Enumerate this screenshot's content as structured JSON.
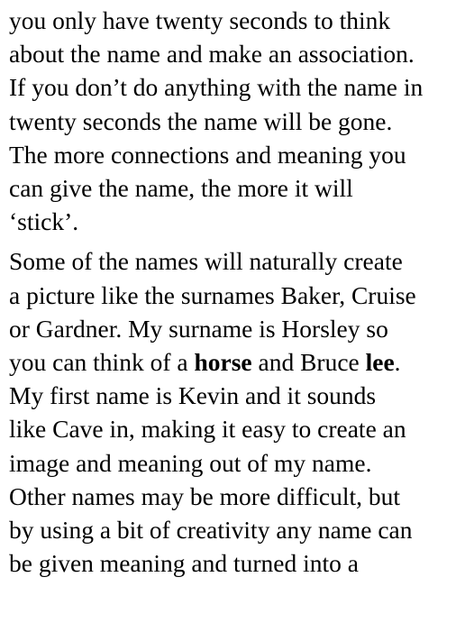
{
  "paragraph_1": {
    "lines": [
      "you only have twenty seconds to think",
      "about the name and make an association.",
      "If you don’t do anything with the name in",
      "twenty seconds the name will be gone.",
      "The more connections and meaning you",
      "can give the name, the more it will",
      "‘stick’."
    ]
  },
  "paragraph_2": {
    "line_1": "Some of the names will naturally create",
    "line_2": "a picture like the surnames Baker, Cruise",
    "line_3": "or Gardner. My surname is Horsley so",
    "line_4_part_1": "you can think of a ",
    "line_4_bold_1": "horse",
    "line_4_part_2": " and Bruce ",
    "line_4_bold_2": "lee",
    "line_4_part_3": ".",
    "line_5": "My first name is Kevin and it sounds",
    "line_6": "like Cave in, making it easy to create an",
    "line_7": "image and meaning out of my name.",
    "line_8": "Other names may be more difficult, but",
    "line_9": "by using a bit of creativity any name can",
    "line_10": "be given meaning and turned into a"
  }
}
